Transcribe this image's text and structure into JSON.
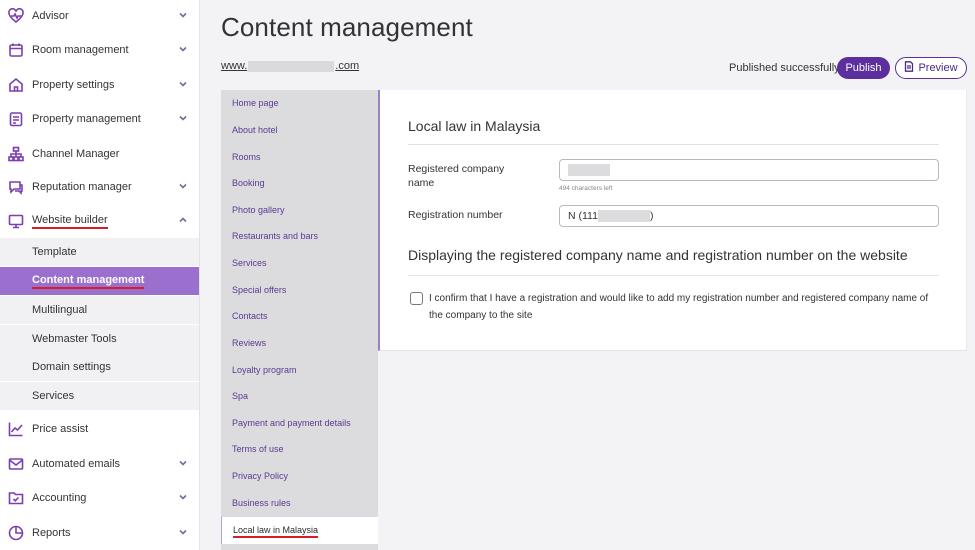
{
  "sidebar": {
    "items": [
      {
        "label": "Advisor",
        "icon": "heart-pulse-icon",
        "expandable": true
      },
      {
        "label": "Room management",
        "icon": "calendar-icon",
        "expandable": true
      },
      {
        "label": "Property settings",
        "icon": "house-icon",
        "expandable": true
      },
      {
        "label": "Property management",
        "icon": "clipboard-icon",
        "expandable": true
      },
      {
        "label": "Channel Manager",
        "icon": "sitemap-icon",
        "expandable": false
      },
      {
        "label": "Reputation manager",
        "icon": "chat-bubble-icon",
        "expandable": true
      },
      {
        "label": "Website builder",
        "icon": "monitor-icon",
        "expandable": true,
        "expanded": true
      },
      {
        "label": "Price assist",
        "icon": "trend-chart-icon",
        "expandable": false
      },
      {
        "label": "Automated emails",
        "icon": "envelope-icon",
        "expandable": true
      },
      {
        "label": "Accounting",
        "icon": "folder-check-icon",
        "expandable": true
      },
      {
        "label": "Reports",
        "icon": "pie-chart-icon",
        "expandable": true
      }
    ],
    "website_builder_sub": [
      {
        "label": "Template"
      },
      {
        "label": "Content management",
        "active": true
      },
      {
        "label": "Multilingual"
      },
      {
        "label": "Webmaster Tools"
      },
      {
        "label": "Domain settings"
      },
      {
        "label": "Services"
      }
    ]
  },
  "header": {
    "title": "Content management",
    "url_prefix": "www.",
    "url_suffix": ".com",
    "status": "Published successfully",
    "publish_label": "Publish",
    "preview_label": "Preview"
  },
  "pages": [
    "Home page",
    "About hotel",
    "Rooms",
    "Booking",
    "Photo gallery",
    "Restaurants and bars",
    "Services",
    "Special offers",
    "Contacts",
    "Reviews",
    "Loyalty program",
    "Spa",
    "Payment and payment details",
    "Terms of use",
    "Privacy Policy",
    "Business rules",
    "Local law in Malaysia"
  ],
  "form": {
    "heading": "Local law in Malaysia",
    "company_label": "Registered company name",
    "chars_left": "494 characters left",
    "regnum_label": "Registration number",
    "regnum_value_prefix": "N (111",
    "regnum_value_suffix": ")",
    "display_heading": "Displaying the registered company name and registration number on the website",
    "confirm_text": "I confirm that I have a registration and would like to add my registration number and registered company name of the company to the site"
  },
  "colors": {
    "accent": "#5b2f9e",
    "active_nav": "#9b6fce",
    "highlight_underline": "#d41f2a"
  }
}
